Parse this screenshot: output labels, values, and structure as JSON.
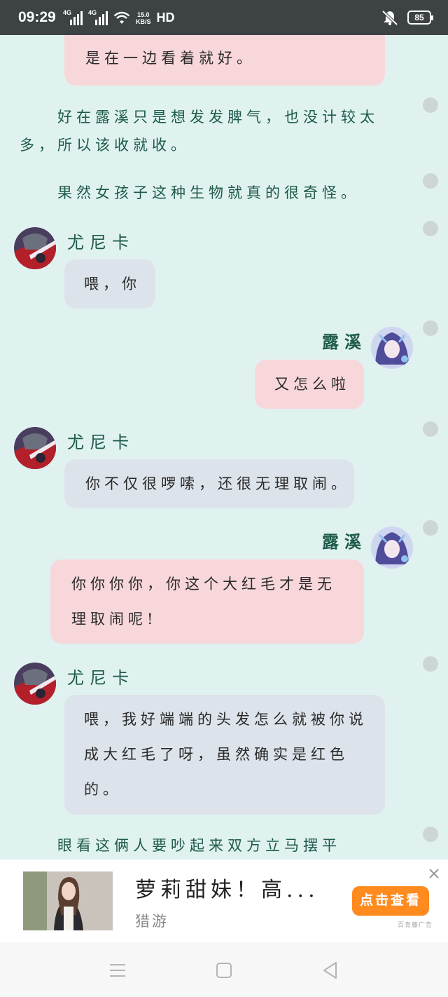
{
  "status_bar": {
    "time": "09:29",
    "sim1": "4G",
    "sim2": "4G",
    "speed_value": "15.0",
    "speed_unit": "KB/S",
    "hd": "HD",
    "battery": "85"
  },
  "reader": {
    "top_bubble": "是在一边看着就好。",
    "narration_1": "好在露溪只是想发发脾气，也没计较太多，所以该收就收。",
    "narration_2": "果然女孩子这种生物就真的很奇怪。",
    "messages": [
      {
        "speaker": "尤尼卡",
        "side": "left",
        "text": "喂，你"
      },
      {
        "speaker": "露溪",
        "side": "right",
        "text": "又怎么啦"
      },
      {
        "speaker": "尤尼卡",
        "side": "left",
        "text": "你不仅很啰嗦，还很无理取闹。"
      },
      {
        "speaker": "露溪",
        "side": "right",
        "text": "你你你你，你这个大红毛才是无理取闹呢!"
      },
      {
        "speaker": "尤尼卡",
        "side": "left",
        "text": "喂，我好端端的头发怎么就被你说成大红毛了呀，虽然确实是红色的。"
      }
    ],
    "narration_3": "眼看这俩人要吵起来双方立马摆平"
  },
  "ad": {
    "title": "萝莉甜妹！高...",
    "source": "猎游",
    "button": "点击查看",
    "tag": "百青藤广告"
  },
  "colors": {
    "background": "#dff2f0",
    "pink_bubble": "#f8d7db",
    "grey_bubble": "#dde3ea",
    "accent_text": "#1f5a4a",
    "ad_button": "#ff8a1e"
  }
}
